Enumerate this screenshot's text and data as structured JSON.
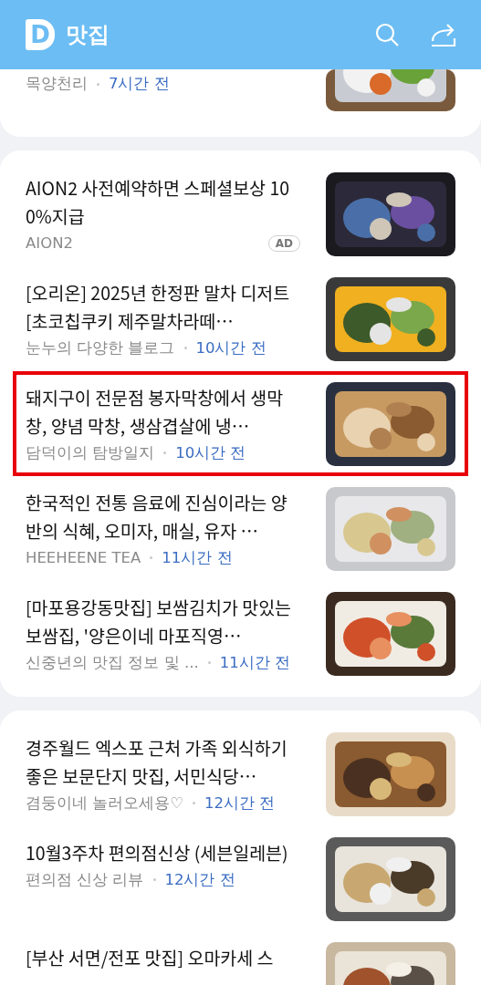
{
  "header": {
    "logo": "D",
    "title": "맛집"
  },
  "sections": [
    {
      "cut_top": true,
      "items": [
        {
          "source": "목양천리",
          "time": "7시간 전",
          "highlighted": false
        }
      ]
    },
    {
      "cut_top": false,
      "items": [
        {
          "title": "AION2 사전예약하면 스페셜보상 100%지급",
          "source": "AION2",
          "badge": "AD",
          "highlighted": false
        },
        {
          "title": "[오리온] 2025년 한정판 말차 디저트 [초코칩쿠키 제주말차라떼…",
          "source": "눈누의 다양한 블로그",
          "time": "10시간 전",
          "highlighted": false
        },
        {
          "title": "돼지구이 전문점 봉자막창에서 생막창, 양념 막창, 생삼겹살에 냉…",
          "source": "담덕이의 탐방일지",
          "time": "10시간 전",
          "highlighted": true
        },
        {
          "title": "한국적인 전통 음료에 진심이라는 양반의 식혜, 오미자, 매실, 유자 …",
          "source": "HEEHEENE TEA",
          "time": "11시간 전",
          "highlighted": false
        },
        {
          "title": "[마포용강동맛집] 보쌈김치가 맛있는 보쌈집, '양은이네 마포직영…",
          "source": "신중년의 맛집 정보 및 ...",
          "time": "11시간 전",
          "highlighted": false
        }
      ]
    },
    {
      "cut_top": false,
      "items": [
        {
          "title": "경주월드 엑스포 근처 가족 외식하기 좋은 보문단지 맛집, 서민식당…",
          "source": "겸둥이네 놀러오세용♡",
          "time": "12시간 전",
          "highlighted": false
        },
        {
          "title": "10월3주차 편의점신상 (세븐일레븐)",
          "source": "편의점 신상 리뷰",
          "time": "12시간 전",
          "highlighted": false
        },
        {
          "title": "[부산 서면/전포 맛집] 오마카세 스",
          "highlighted": false
        }
      ]
    }
  ]
}
